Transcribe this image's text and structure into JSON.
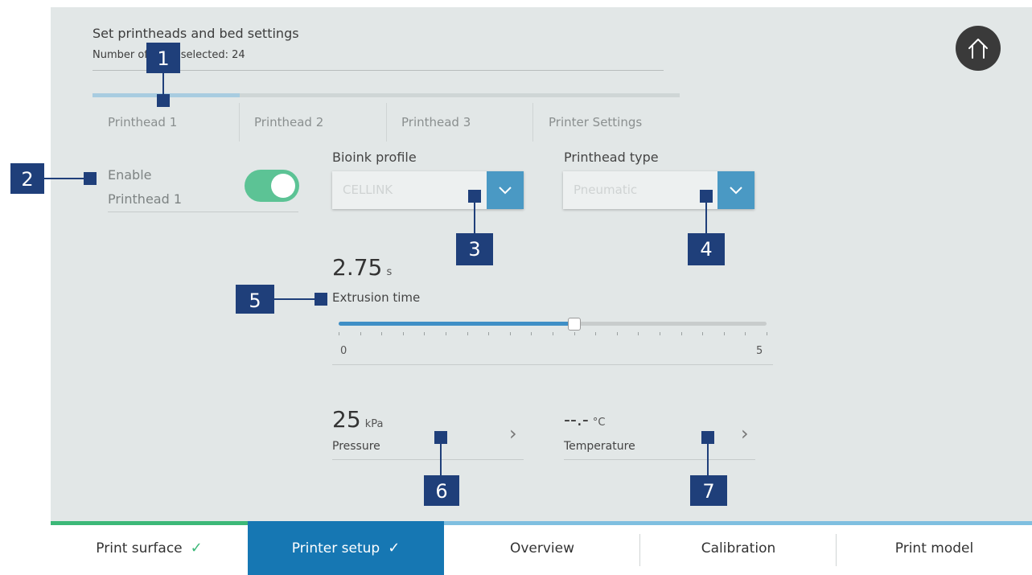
{
  "header": {
    "title": "Set printheads and bed settings",
    "subtitle": "Number of wells selected: 24"
  },
  "tabs": [
    {
      "label": "Printhead 1",
      "active": true
    },
    {
      "label": "Printhead 2",
      "active": false
    },
    {
      "label": "Printhead 3",
      "active": false
    },
    {
      "label": "Printer Settings",
      "active": false
    }
  ],
  "enable": {
    "label_line1": "Enable",
    "label_line2": "Printhead 1",
    "on": true
  },
  "bioink": {
    "label": "Bioink profile",
    "value": "CELLINK"
  },
  "printhead_type": {
    "label": "Printhead type",
    "value": "Pneumatic"
  },
  "extrusion": {
    "value": "2.75",
    "unit": "s",
    "label": "Extrusion time",
    "min": "0",
    "max": "5",
    "fraction": 0.55
  },
  "pressure": {
    "value": "25",
    "unit": "kPa",
    "label": "Pressure"
  },
  "temperature": {
    "value": "--.-",
    "unit": "°C",
    "label": "Temperature"
  },
  "markers": [
    "1",
    "2",
    "3",
    "4",
    "5",
    "6",
    "7"
  ],
  "bottom_tabs": [
    {
      "label": "Print surface",
      "done": true
    },
    {
      "label": "Printer setup",
      "done": true
    },
    {
      "label": "Overview"
    },
    {
      "label": "Calibration"
    },
    {
      "label": "Print model"
    }
  ],
  "colors": {
    "accent_blue": "#4a99c4",
    "active_tab": "#1677b3",
    "toggle_green": "#5cc395",
    "marker": "#1f3f7a",
    "check_green": "#3cb878"
  },
  "icons": {
    "home": "home-icon",
    "chevron_down": "chevron-down-icon",
    "chevron_right": "chevron-right-icon",
    "check": "check-icon"
  }
}
